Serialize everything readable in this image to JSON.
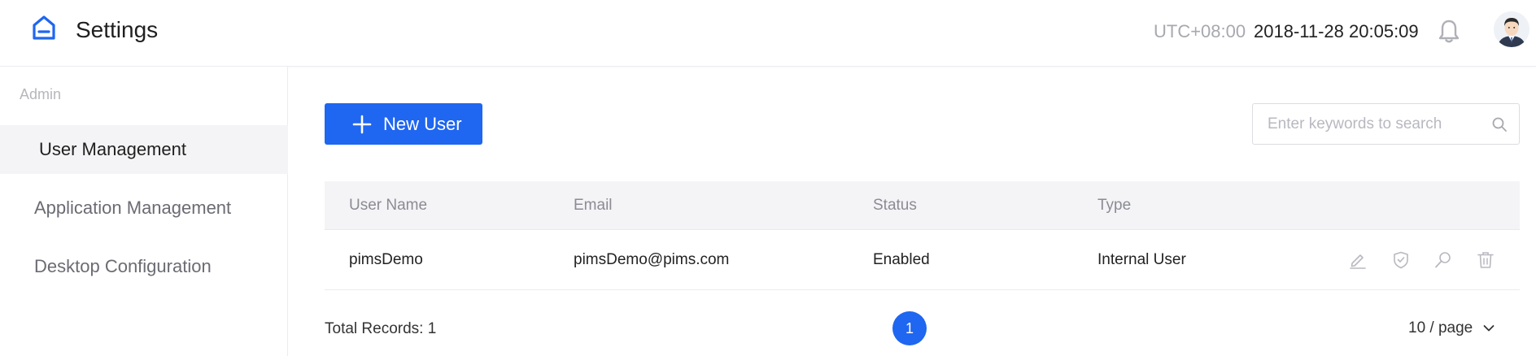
{
  "header": {
    "title": "Settings",
    "timezone": "UTC+08:00",
    "datetime": "2018-11-28 20:05:09"
  },
  "sidebar": {
    "section": "Admin",
    "items": [
      {
        "label": "User Management",
        "active": true
      },
      {
        "label": "Application Management",
        "active": false
      },
      {
        "label": "Desktop Configuration",
        "active": false
      }
    ]
  },
  "toolbar": {
    "new_user_label": "New User",
    "search_placeholder": "Enter keywords to search",
    "search_value": ""
  },
  "table": {
    "columns": [
      "User Name",
      "Email",
      "Status",
      "Type"
    ],
    "rows": [
      {
        "user_name": "pimsDemo",
        "email": "pimsDemo@pims.com",
        "status": "Enabled",
        "type": "Internal User"
      }
    ],
    "row_actions": [
      "edit-icon",
      "shield-check-icon",
      "search-icon",
      "trash-icon"
    ]
  },
  "pagination": {
    "total": "Total Records: 1",
    "current_page": "1",
    "page_size": "10 / page"
  },
  "colors": {
    "accent": "#1f66f0",
    "header_bg": "#f4f4f7",
    "muted_text": "#8b8b93"
  }
}
